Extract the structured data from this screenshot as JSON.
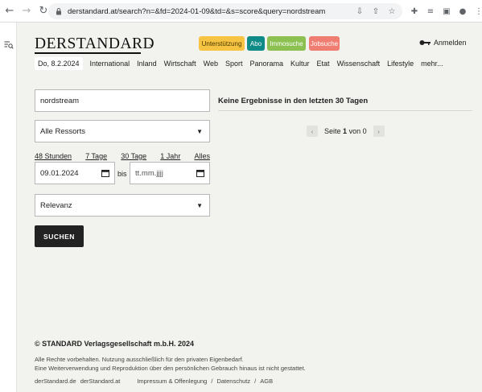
{
  "browser": {
    "url": "derstandard.at/search?n=&fd=2024-01-09&td=&s=score&query=nordstream"
  },
  "header": {
    "logo": "DERSTANDARD",
    "pills": {
      "support": "Unterstützung",
      "abo": "Abo",
      "immo": "Immosuche",
      "jobs": "Jobsuche"
    },
    "login": "Anmelden"
  },
  "nav": {
    "date": "Do, 8.2.2024",
    "items": [
      "International",
      "Inland",
      "Wirtschaft",
      "Web",
      "Sport",
      "Panorama",
      "Kultur",
      "Etat",
      "Wissenschaft",
      "Lifestyle",
      "mehr..."
    ]
  },
  "search": {
    "query": "nordstream",
    "ressorts": "Alle Ressorts",
    "ranges": [
      "48 Stunden",
      "7 Tage",
      "30 Tage",
      "1 Jahr",
      "Alles"
    ],
    "date_from": "09.01.2024",
    "bis": "bis",
    "date_to_placeholder": "tt.mm.jjjj",
    "sort": "Relevanz",
    "submit": "SUCHEN"
  },
  "results": {
    "message": "Keine Ergebnisse in den letzten 30 Tagen",
    "page_prefix": "Seite",
    "page_current": "1",
    "page_of": "von",
    "page_total": "0"
  },
  "footer": {
    "copyright": "© STANDARD Verlagsgesellschaft m.b.H. 2024",
    "rights_line1": "Alle Rechte vorbehalten. Nutzung ausschließlich für den privaten Eigenbedarf.",
    "rights_line2": "Eine Weiterverwendung und Reproduktion über den persönlichen Gebrauch hinaus ist nicht gestattet.",
    "links": [
      "derStandard.de",
      "derStandard.at",
      "Impressum & Offenlegung",
      "/",
      "Datenschutz",
      "/",
      "AGB"
    ]
  },
  "icons": {
    "back": "arrow-left-icon",
    "forward": "arrow-right-icon",
    "reload": "reload-icon",
    "lock": "lock-icon",
    "key": "key-icon",
    "calendar": "calendar-icon"
  }
}
